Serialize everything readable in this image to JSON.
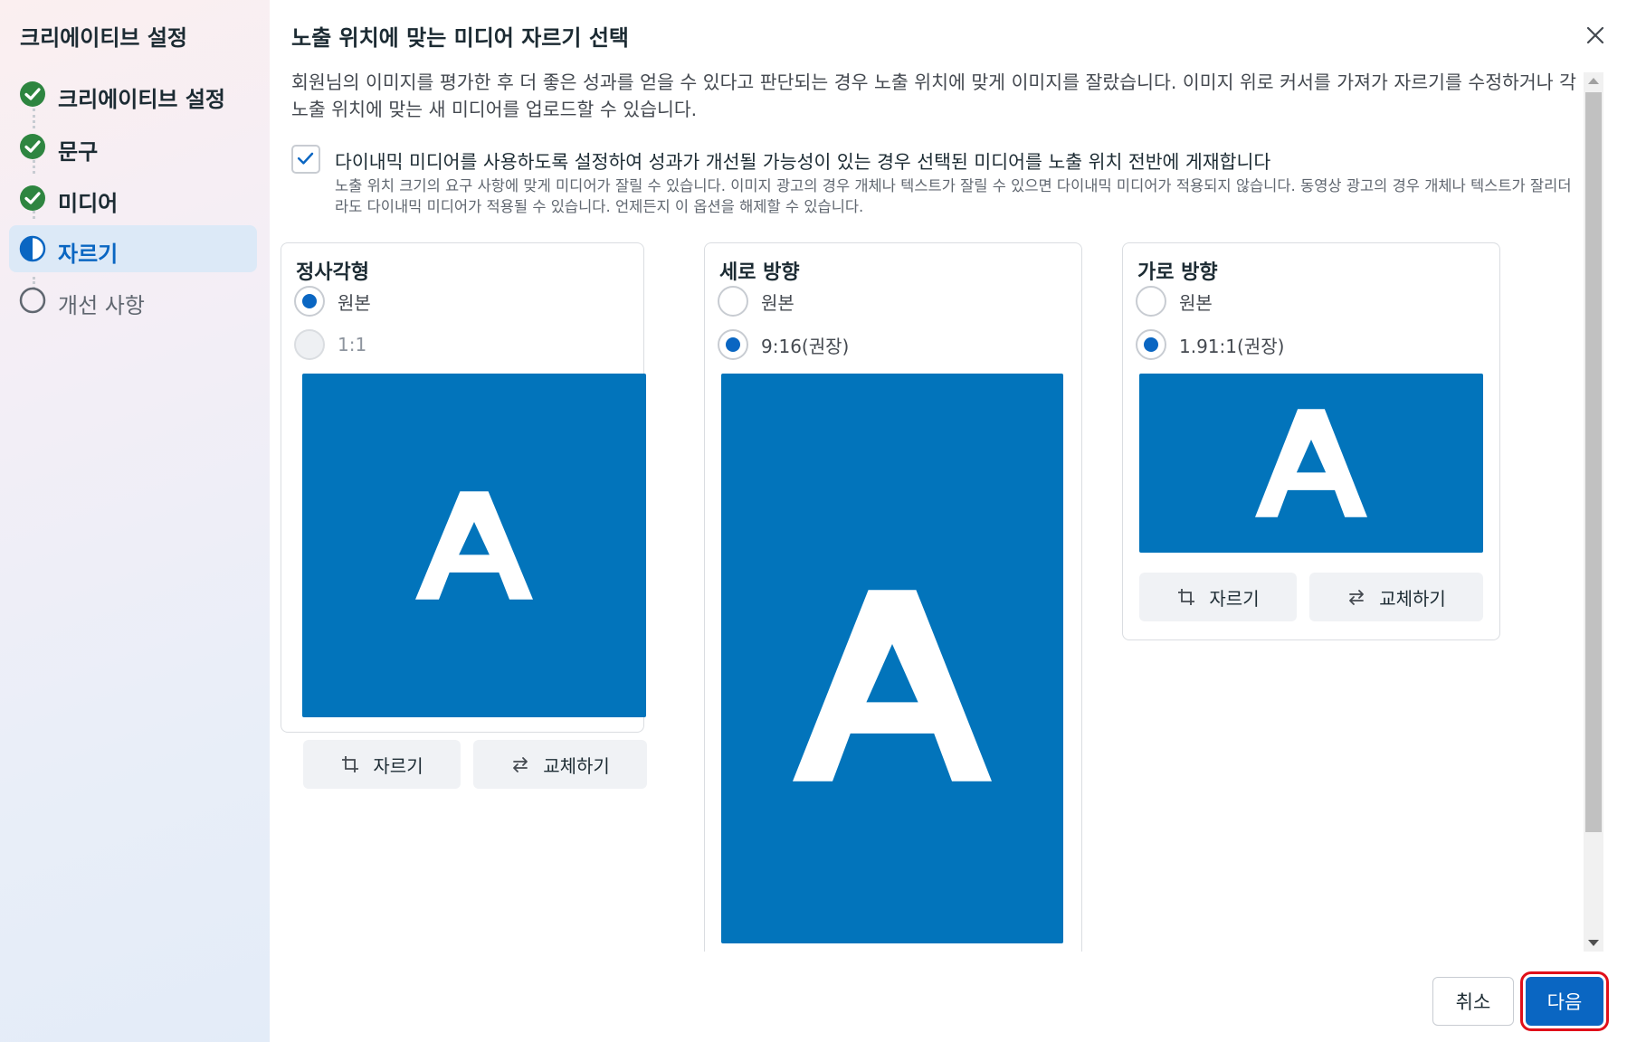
{
  "sidebar": {
    "title": "크리에이티브 설정",
    "steps": [
      {
        "label": "크리에이티브 설정",
        "state": "done"
      },
      {
        "label": "문구",
        "state": "done"
      },
      {
        "label": "미디어",
        "state": "done"
      },
      {
        "label": "자르기",
        "state": "active"
      },
      {
        "label": "개선 사항",
        "state": "pending"
      }
    ]
  },
  "dialog": {
    "title": "노출 위치에 맞는 미디어 자르기 선택",
    "description": "회원님의 이미지를 평가한 후 더 좋은 성과를 얻을 수 있다고 판단되는 경우 노출 위치에 맞게 이미지를 잘랐습니다. 이미지 위로 커서를 가져가 자르기를 수정하거나 각 노출 위치에 맞는 새 미디어를 업로드할 수 있습니다.",
    "dynamic_media": {
      "checked": true,
      "label": "다이내믹 미디어를 사용하도록 설정하여 성과가 개선될 가능성이 있는 경우 선택된 미디어를 노출 위치 전반에 게재합니다",
      "sublabel": "노출 위치 크기의 요구 사항에 맞게 미디어가 잘릴 수 있습니다. 이미지 광고의 경우 개체나 텍스트가 잘릴 수 있으면 다이내믹 미디어가 적용되지 않습니다. 동영상 광고의 경우 개체나 텍스트가 잘리더라도 다이내믹 미디어가 적용될 수 있습니다. 언제든지 이 옵션을 해제할 수 있습니다."
    },
    "cards": [
      {
        "title": "정사각형",
        "options": [
          {
            "label": "원본",
            "selected": true,
            "disabled": false
          },
          {
            "label": "1:1",
            "selected": false,
            "disabled": true
          }
        ],
        "preview_letter": "A",
        "crop_label": "자르기",
        "replace_label": "교체하기"
      },
      {
        "title": "세로 방향",
        "options": [
          {
            "label": "원본",
            "selected": false,
            "disabled": false
          },
          {
            "label": "9:16(권장)",
            "selected": true,
            "disabled": false
          }
        ],
        "preview_letter": "A"
      },
      {
        "title": "가로 방향",
        "options": [
          {
            "label": "원본",
            "selected": false,
            "disabled": false
          },
          {
            "label": "1.91:1(권장)",
            "selected": true,
            "disabled": false
          }
        ],
        "preview_letter": "A",
        "crop_label": "자르기",
        "replace_label": "교체하기"
      }
    ],
    "footer": {
      "cancel_label": "취소",
      "next_label": "다음"
    }
  },
  "colors": {
    "accent": "#0a66c2",
    "preview_bg": "#0274bb",
    "success": "#2e8540",
    "highlight_border": "#e0101a"
  }
}
